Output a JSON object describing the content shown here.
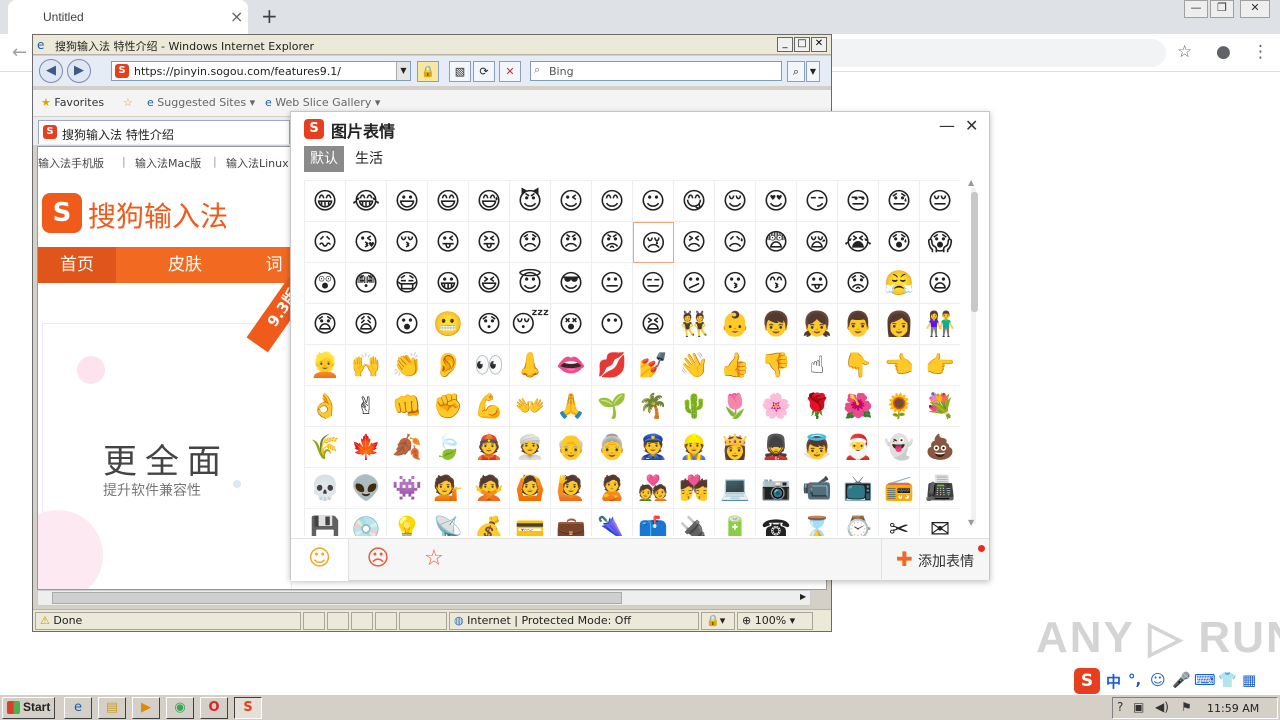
{
  "chrome": {
    "tab_title": "Untitled",
    "tab_close": "×",
    "new_tab": "+",
    "back_icon": "←",
    "bookmark_icon": "☆",
    "account_icon": "●",
    "menu_icon": "⋮",
    "win_min": "—",
    "win_restore": "❐",
    "win_close": "✕"
  },
  "ie": {
    "title": "搜狗输入法 特性介绍 - Windows Internet Explorer",
    "address": "https://pinyin.sogou.com/features9.1/",
    "search_placeholder": "Bing",
    "favorites_label": "Favorites",
    "suggested_sites": "Suggested Sites ▾",
    "web_slice_gallery": "Web Slice Gallery ▾",
    "tab_title": "搜狗输入法 特性介绍",
    "status_done": "Done",
    "status_zone": "Internet | Protected Mode: Off",
    "zoom": "100%",
    "btn_min": "_",
    "btn_max": "□",
    "btn_close": "✕"
  },
  "site": {
    "top_nav": [
      "输入法手机版",
      "|",
      "输入法Mac版",
      "|",
      "输入法Linux"
    ],
    "brand": "搜狗输入法",
    "logo_letter": "S",
    "menu": [
      "首页",
      "皮肤",
      "词"
    ],
    "banner_head": "更全面",
    "banner_sub": "提升软件兼容性",
    "ribbon": "9.3版"
  },
  "panel": {
    "logo_letter": "S",
    "title": "图片表情",
    "minimize": "—",
    "close": "✕",
    "tabs": [
      "默认",
      "生活"
    ],
    "add_label": "添加表情",
    "add_plus": "✚",
    "categories": [
      {
        "icon": "☺",
        "name": "smiley-category-icon"
      },
      {
        "icon": "☹",
        "name": "face-category-icon"
      },
      {
        "icon": "☆",
        "name": "favorite-category-icon"
      }
    ],
    "emoji_rows": [
      [
        "😁",
        "😂",
        "😃",
        "😄",
        "😅",
        "😈",
        "😉",
        "😊",
        "☺",
        "😋",
        "😌",
        "😍",
        "😏",
        "😒",
        "😓",
        "😔"
      ],
      [
        "😖",
        "😘",
        "😚",
        "😜",
        "😝",
        "😞",
        "😠",
        "😡",
        "😢",
        "😣",
        "😥",
        "😨",
        "😪",
        "😭",
        "😰",
        "😱"
      ],
      [
        "😲",
        "😳",
        "😷",
        "😀",
        "😆",
        "😇",
        "😎",
        "😐",
        "😑",
        "😕",
        "😗",
        "😙",
        "😛",
        "😟",
        "😤",
        "😦"
      ],
      [
        "😧",
        "😩",
        "😮",
        "😬",
        "😯",
        "😴",
        "😵",
        "😶",
        "😫",
        "👯",
        "👶",
        "👦",
        "👧",
        "👨",
        "👩",
        "👫"
      ],
      [
        "👱",
        "🙌",
        "👏",
        "👂",
        "👀",
        "👃",
        "👄",
        "💋",
        "💅",
        "👋",
        "👍",
        "👎",
        "☝",
        "👇",
        "👈",
        "👉"
      ],
      [
        "👌",
        "✌",
        "👊",
        "✊",
        "💪",
        "👐",
        "🙏",
        "🌱",
        "🌴",
        "🌵",
        "🌷",
        "🌸",
        "🌹",
        "🌺",
        "🌻",
        "💐"
      ],
      [
        "🌾",
        "🍁",
        "🍂",
        "🍃",
        "👲",
        "👳",
        "👴",
        "👵",
        "👮",
        "👷",
        "👸",
        "💂",
        "👼",
        "🎅",
        "👻",
        "💩"
      ],
      [
        "💀",
        "👽",
        "👾",
        "💁",
        "🙅",
        "🙆",
        "🙋",
        "🙎",
        "💑",
        "💏",
        "💻",
        "📷",
        "📹",
        "📺",
        "📻",
        "📠"
      ],
      [
        "💾",
        "💿",
        "💡",
        "📡",
        "💰",
        "💳",
        "💼",
        "🌂",
        "📫",
        "🔌",
        "🔋",
        "☎",
        "⌛",
        "⌚",
        "✂",
        "✉"
      ]
    ]
  },
  "watermark": "ANY ▷ RUN",
  "ime": {
    "logo_letter": "S",
    "items": [
      "中",
      "°,",
      "☺",
      "🎤",
      "⌨",
      "👕",
      "▦"
    ]
  },
  "taskbar": {
    "start_label": "Start",
    "apps": [
      {
        "icon": "e",
        "name": "ie-taskbar-icon"
      },
      {
        "icon": "▤",
        "name": "explorer-taskbar-icon"
      },
      {
        "icon": "▶",
        "name": "media-taskbar-icon"
      },
      {
        "icon": "◉",
        "name": "chrome-taskbar-icon"
      },
      {
        "icon": "O",
        "name": "opera-taskbar-icon"
      },
      {
        "icon": "S",
        "name": "sogou-taskbar-icon"
      }
    ],
    "tray_icons": [
      "?",
      "▣",
      "◀)",
      "⚑"
    ],
    "clock": "11:59 AM"
  },
  "colors": {
    "sogou_orange": "#f26a21",
    "sogou_red": "#e63e1f"
  }
}
